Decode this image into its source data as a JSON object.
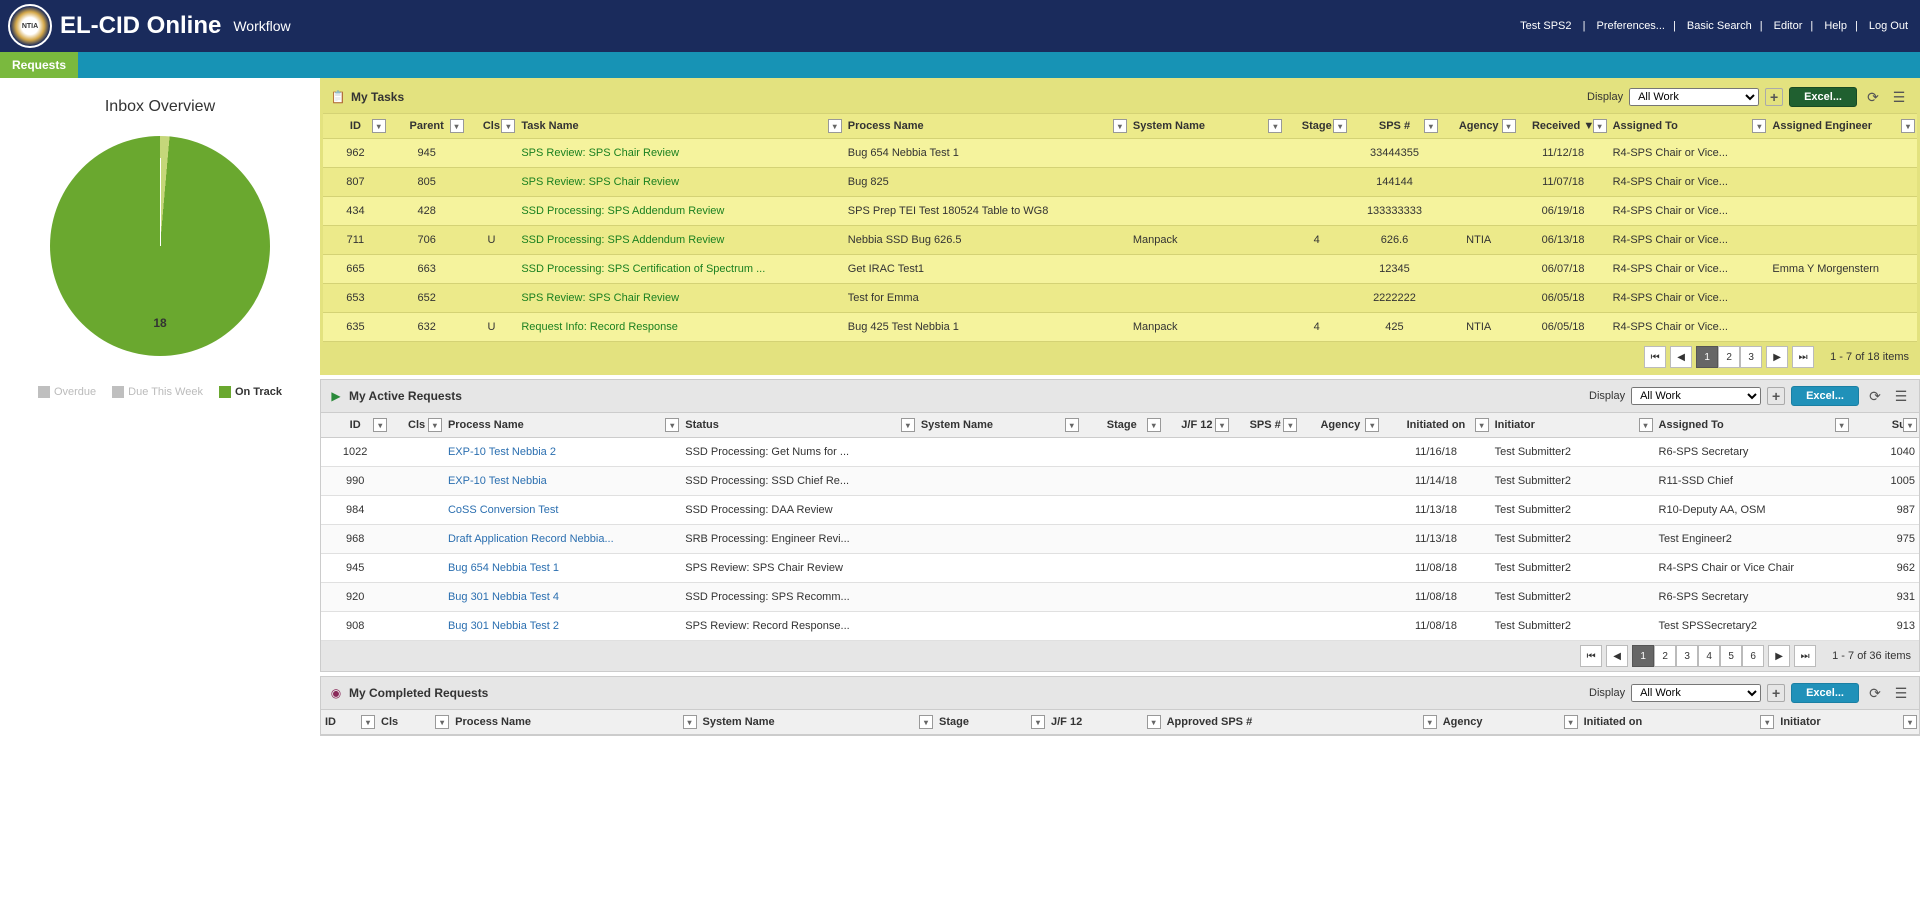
{
  "header": {
    "app_title": "EL-CID Online",
    "subtitle": "Workflow",
    "user": "Test SPS2",
    "links": [
      "Preferences...",
      "Basic Search",
      "Editor",
      "Help",
      "Log Out"
    ]
  },
  "nav": {
    "tab_requests": "Requests"
  },
  "sidebar": {
    "title": "Inbox Overview",
    "count": "18",
    "legend": [
      {
        "label": "Overdue",
        "color": "#bfbfbf"
      },
      {
        "label": "Due This Week",
        "color": "#bfbfbf"
      },
      {
        "label": "On Track",
        "color": "#6aa82f"
      }
    ]
  },
  "panels": {
    "tasks": {
      "title": "My Tasks",
      "display_label": "Display",
      "display_value": "All Work",
      "excel": "Excel...",
      "headers": [
        "ID",
        "Parent",
        "Cls",
        "Task Name",
        "Process Name",
        "System Name",
        "Stage",
        "SPS #",
        "Agency",
        "Received ▼",
        "Assigned To",
        "Assigned Engineer"
      ],
      "rows": [
        {
          "id": "962",
          "parent": "945",
          "cls": "",
          "task": "SPS Review: SPS Chair Review",
          "proc": "Bug 654 Nebbia Test 1",
          "sys": "",
          "stage": "",
          "sps": "33444355",
          "agency": "",
          "recv": "11/12/18",
          "assgn": "R4-SPS Chair or Vice...",
          "eng": ""
        },
        {
          "id": "807",
          "parent": "805",
          "cls": "",
          "task": "SPS Review: SPS Chair Review",
          "proc": "Bug 825",
          "sys": "",
          "stage": "",
          "sps": "144144",
          "agency": "",
          "recv": "11/07/18",
          "assgn": "R4-SPS Chair or Vice...",
          "eng": ""
        },
        {
          "id": "434",
          "parent": "428",
          "cls": "",
          "task": "SSD Processing: SPS Addendum Review",
          "proc": "SPS Prep TEI Test 180524 Table to WG8",
          "sys": "",
          "stage": "",
          "sps": "133333333",
          "agency": "",
          "recv": "06/19/18",
          "assgn": "R4-SPS Chair or Vice...",
          "eng": ""
        },
        {
          "id": "711",
          "parent": "706",
          "cls": "U",
          "task": "SSD Processing: SPS Addendum Review",
          "proc": "Nebbia SSD Bug 626.5",
          "sys": "Manpack",
          "stage": "4",
          "sps": "626.6",
          "agency": "NTIA",
          "recv": "06/13/18",
          "assgn": "R4-SPS Chair or Vice...",
          "eng": ""
        },
        {
          "id": "665",
          "parent": "663",
          "cls": "",
          "task": "SSD Processing: SPS Certification of Spectrum ...",
          "proc": "Get IRAC Test1",
          "sys": "",
          "stage": "",
          "sps": "12345",
          "agency": "",
          "recv": "06/07/18",
          "assgn": "R4-SPS Chair or Vice...",
          "eng": "Emma Y Morgenstern"
        },
        {
          "id": "653",
          "parent": "652",
          "cls": "",
          "task": "SPS Review: SPS Chair Review",
          "proc": "Test for Emma",
          "sys": "",
          "stage": "",
          "sps": "2222222",
          "agency": "",
          "recv": "06/05/18",
          "assgn": "R4-SPS Chair or Vice...",
          "eng": ""
        },
        {
          "id": "635",
          "parent": "632",
          "cls": "U",
          "task": "Request Info: Record Response",
          "proc": "Bug 425 Test Nebbia 1",
          "sys": "Manpack",
          "stage": "4",
          "sps": "425",
          "agency": "NTIA",
          "recv": "06/05/18",
          "assgn": "R4-SPS Chair or Vice...",
          "eng": ""
        }
      ],
      "pager": {
        "pages": [
          "1",
          "2",
          "3"
        ],
        "active": "1",
        "info": "1 - 7 of 18 items"
      }
    },
    "active": {
      "title": "My Active Requests",
      "display_label": "Display",
      "display_value": "All Work",
      "excel": "Excel...",
      "headers": [
        "ID",
        "Cls",
        "Process Name",
        "Status",
        "System Name",
        "Stage",
        "J/F 12",
        "SPS #",
        "Agency",
        "Initiated on",
        "Initiator",
        "Assigned To",
        "Su..."
      ],
      "rows": [
        {
          "id": "1022",
          "cls": "",
          "proc": "EXP-10 Test Nebbia 2",
          "stat": "SSD Processing: Get Nums for ...",
          "sys": "",
          "stage": "",
          "jf": "",
          "sps": "",
          "ag": "",
          "init": "11/16/18",
          "initr": "Test Submitter2",
          "assgn": "R6-SPS Secretary",
          "su": "1040"
        },
        {
          "id": "990",
          "cls": "",
          "proc": "EXP-10 Test Nebbia",
          "stat": "SSD Processing: SSD Chief Re...",
          "sys": "",
          "stage": "",
          "jf": "",
          "sps": "",
          "ag": "",
          "init": "11/14/18",
          "initr": "Test Submitter2",
          "assgn": "R11-SSD Chief",
          "su": "1005"
        },
        {
          "id": "984",
          "cls": "",
          "proc": "CoSS Conversion Test",
          "stat": "SSD Processing: DAA Review",
          "sys": "",
          "stage": "",
          "jf": "",
          "sps": "",
          "ag": "",
          "init": "11/13/18",
          "initr": "Test Submitter2",
          "assgn": "R10-Deputy AA, OSM",
          "su": "987"
        },
        {
          "id": "968",
          "cls": "",
          "proc": "Draft Application Record Nebbia...",
          "stat": "SRB Processing: Engineer Revi...",
          "sys": "",
          "stage": "",
          "jf": "",
          "sps": "",
          "ag": "",
          "init": "11/13/18",
          "initr": "Test Submitter2",
          "assgn": "Test Engineer2",
          "su": "975"
        },
        {
          "id": "945",
          "cls": "",
          "proc": "Bug 654 Nebbia Test 1",
          "stat": "SPS Review: SPS Chair Review",
          "sys": "",
          "stage": "",
          "jf": "",
          "sps": "",
          "ag": "",
          "init": "11/08/18",
          "initr": "Test Submitter2",
          "assgn": "R4-SPS Chair or Vice Chair",
          "su": "962"
        },
        {
          "id": "920",
          "cls": "",
          "proc": "Bug 301 Nebbia Test 4",
          "stat": "SSD Processing: SPS Recomm...",
          "sys": "",
          "stage": "",
          "jf": "",
          "sps": "",
          "ag": "",
          "init": "11/08/18",
          "initr": "Test Submitter2",
          "assgn": "R6-SPS Secretary",
          "su": "931"
        },
        {
          "id": "908",
          "cls": "",
          "proc": "Bug 301 Nebbia Test 2",
          "stat": "SPS Review: Record Response...",
          "sys": "",
          "stage": "",
          "jf": "",
          "sps": "",
          "ag": "",
          "init": "11/08/18",
          "initr": "Test Submitter2",
          "assgn": "Test SPSSecretary2",
          "su": "913"
        }
      ],
      "pager": {
        "pages": [
          "1",
          "2",
          "3",
          "4",
          "5",
          "6"
        ],
        "active": "1",
        "info": "1 - 7 of 36 items"
      }
    },
    "completed": {
      "title": "My Completed Requests",
      "display_label": "Display",
      "display_value": "All Work",
      "excel": "Excel...",
      "headers": [
        "ID",
        "Cls",
        "Process Name",
        "System Name",
        "Stage",
        "J/F 12",
        "Approved SPS #",
        "Agency",
        "Initiated on",
        "Initiator"
      ]
    }
  },
  "chart_data": {
    "type": "pie",
    "title": "Inbox Overview",
    "series": [
      {
        "name": "Overdue",
        "value": 0,
        "color": "#bfbfbf"
      },
      {
        "name": "Due This Week",
        "value": 0,
        "color": "#bfbfbf"
      },
      {
        "name": "On Track",
        "value": 18,
        "color": "#6aa82f"
      }
    ],
    "total": 18
  }
}
